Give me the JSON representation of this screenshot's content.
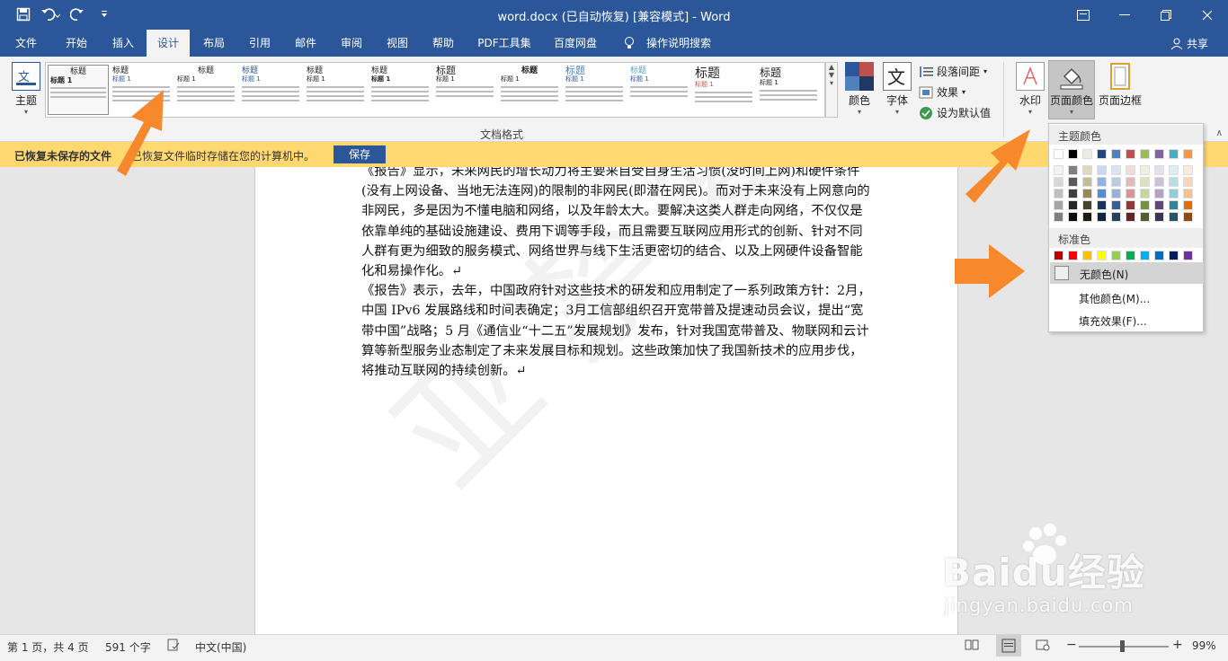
{
  "window": {
    "title": "word.docx (已自动恢复) [兼容模式] - Word",
    "qat": [
      "save-icon",
      "undo-icon",
      "redo-icon",
      "customize-icon"
    ]
  },
  "tabs": [
    {
      "label": "文件"
    },
    {
      "label": "开始"
    },
    {
      "label": "插入"
    },
    {
      "label": "设计",
      "active": true
    },
    {
      "label": "布局"
    },
    {
      "label": "引用"
    },
    {
      "label": "邮件"
    },
    {
      "label": "审阅"
    },
    {
      "label": "视图"
    },
    {
      "label": "帮助"
    },
    {
      "label": "PDF工具集"
    },
    {
      "label": "百度网盘"
    },
    {
      "label": "操作说明搜索"
    }
  ],
  "share_label": "共享",
  "ribbon": {
    "theme_label": "主题",
    "gallery": [
      {
        "title": "标题",
        "sub": "标题 1"
      },
      {
        "title": "标题",
        "sub": "标题 1"
      },
      {
        "title": "标题",
        "sub": "标题 1"
      },
      {
        "title": "标题",
        "sub": "标题 1"
      },
      {
        "title": "标题",
        "sub": "标题 1"
      },
      {
        "title": "标题",
        "sub": "标题 1"
      },
      {
        "title": "标题",
        "sub": "标题 1"
      },
      {
        "title": "标题",
        "sub": "标题 1"
      },
      {
        "title": "标题",
        "sub": "标题 1"
      },
      {
        "title": "标题",
        "sub": "标题 1"
      },
      {
        "title": "标题",
        "sub": "标题 1"
      },
      {
        "title": "标题",
        "sub": "标题 1"
      }
    ],
    "group_label": "文档格式",
    "colors_label": "颜色",
    "fonts_label": "字体",
    "para_spacing_label": "段落间距",
    "effects_label": "效果",
    "set_default_label": "设为默认值",
    "watermark_label": "水印",
    "page_color_label": "页面颜色",
    "page_border_label": "页面边框"
  },
  "notice": {
    "bold": "已恢复未保存的文件",
    "text": "已恢复文件临时存储在您的计算机中。",
    "button": "保存"
  },
  "document": {
    "paragraphs": [
      "《报告》显示，未来网民的增长动力将主要来自受自身生活习惯(没时间上网)和硬件条件(没有上网设备、当地无法连网)的限制的非网民(即潜在网民)。而对于未来没有上网意向的非网民，多是因为不懂电脑和网络，以及年龄太大。要解决这类人群走向网络，不仅仅是依靠单纯的基础设施建设、费用下调等手段，而且需要互联网应用形式的创新、针对不同人群有更为细致的服务模式、网络世界与线下生活更密切的结合、以及上网硬件设备智能化和易操作化。↵",
      "《报告》表示，去年，中国政府针对这些技术的研发和应用制定了一系列政策方针：2月，中国 IPv6 发展路线和时间表确定；3月工信部组织召开宽带普及提速动员会议，提出“宽带中国”战略；5 月《通信业“十二五”发展规划》发布，针对我国宽带普及、物联网和云计算等新型服务业态制定了未来发展目标和规划。这些政策加快了我国新技术的应用步伐，将推动互联网的持续创新。↵"
    ],
    "watermark_text": "亚 禁 复 制"
  },
  "page_color_menu": {
    "theme_colors_label": "主题颜色",
    "theme_top_row": [
      "#ffffff",
      "#000000",
      "#eeece1",
      "#1f497d",
      "#4f81bd",
      "#c0504d",
      "#9bbb59",
      "#8064a2",
      "#4bacc6",
      "#f79646"
    ],
    "theme_shades": [
      [
        "#f2f2f2",
        "#7f7f7f",
        "#ddd9c3",
        "#c6d9f0",
        "#dbe5f1",
        "#f2dcdb",
        "#ebf1dd",
        "#e5e0ec",
        "#dbeef3",
        "#fdeada"
      ],
      [
        "#d8d8d8",
        "#595959",
        "#c4bd97",
        "#8db3e2",
        "#b8cce4",
        "#e5b9b7",
        "#d7e3bc",
        "#ccc1d9",
        "#b7dde8",
        "#fbd5b5"
      ],
      [
        "#bfbfbf",
        "#3f3f3f",
        "#938953",
        "#548dd4",
        "#95b3d7",
        "#d99694",
        "#c3d69b",
        "#b2a2c7",
        "#92cddc",
        "#fac08f"
      ],
      [
        "#a5a5a5",
        "#262626",
        "#494429",
        "#17365d",
        "#366092",
        "#953734",
        "#76923c",
        "#5f497a",
        "#31859b",
        "#e36c09"
      ],
      [
        "#7f7f7f",
        "#0c0c0c",
        "#1d1b10",
        "#0f243e",
        "#244061",
        "#632423",
        "#4f6128",
        "#3f3151",
        "#205867",
        "#974806"
      ]
    ],
    "standard_label": "标准色",
    "standard_colors": [
      "#c00000",
      "#ff0000",
      "#ffc000",
      "#ffff00",
      "#92d050",
      "#00b050",
      "#00b0f0",
      "#0070c0",
      "#002060",
      "#7030a0"
    ],
    "no_color_label": "无颜色(N)",
    "more_colors_label": "其他颜色(M)...",
    "fill_effects_label": "填充效果(F)..."
  },
  "status": {
    "page": "第 1 页，共 4 页",
    "words": "591 个字",
    "language": "中文(中国)",
    "zoom": "99%"
  },
  "overlay": {
    "baidu_text": "Baidu经验",
    "baidu_url": "jingyan.baidu.com"
  },
  "accent_color": "#2b579a",
  "arrow_color": "#f7892c"
}
